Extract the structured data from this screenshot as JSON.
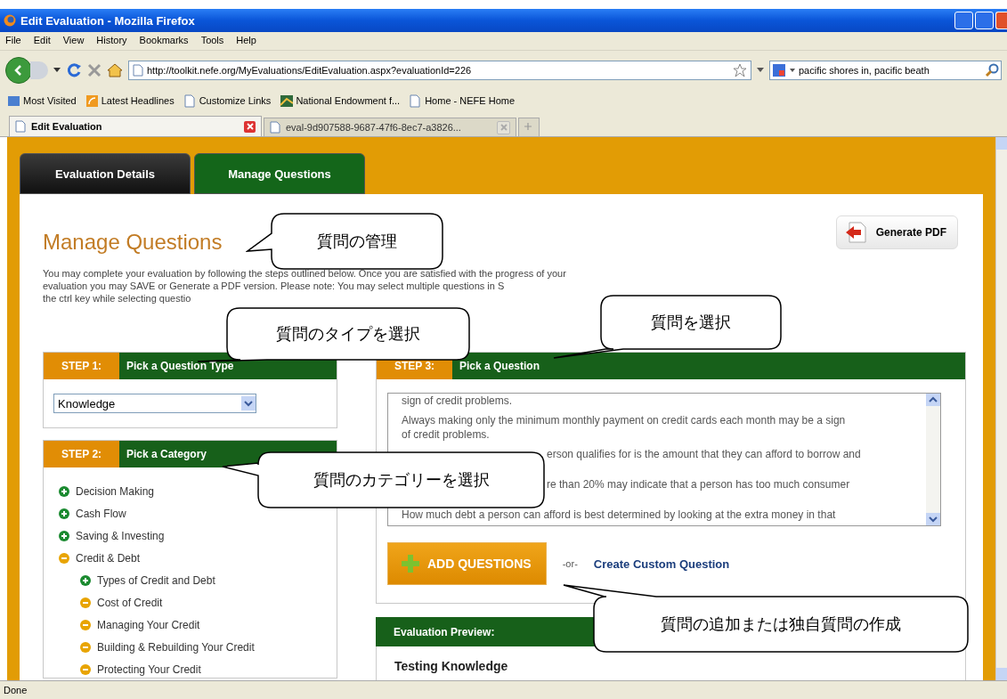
{
  "window": {
    "title": "Edit Evaluation - Mozilla Firefox"
  },
  "menu": [
    "File",
    "Edit",
    "View",
    "History",
    "Bookmarks",
    "Tools",
    "Help"
  ],
  "toolbar": {
    "url": "http://toolkit.nefe.org/MyEvaluations/EditEvaluation.aspx?evaluationId=226",
    "search_value": "pacific shores in, pacific beath"
  },
  "bookmarks": [
    {
      "kind": "rss",
      "label": "Most Visited"
    },
    {
      "kind": "feed",
      "label": "Latest Headlines"
    },
    {
      "kind": "page",
      "label": "Customize Links"
    },
    {
      "kind": "site",
      "label": "National Endowment f..."
    },
    {
      "kind": "page",
      "label": "Home - NEFE Home"
    }
  ],
  "browser_tabs": [
    {
      "label": "Edit Evaluation",
      "selected": true
    },
    {
      "label": "eval-9d907588-9687-47f6-8ec7-a3826...",
      "selected": false
    }
  ],
  "page": {
    "tabs": [
      {
        "label": "Evaluation Details",
        "selected": false
      },
      {
        "label": "Manage Questions",
        "selected": true
      }
    ],
    "heading": "Manage Questions",
    "pdf_button": "Generate PDF",
    "intro_lines": [
      "You may complete your evaluation by following the steps outlined below. Once you are satisfied with the progress of your",
      "evaluation you may SAVE or Generate a PDF version. Please note: You may select multiple questions in S",
      "the ctrl key while selecting questio"
    ],
    "step1": {
      "step": "STEP 1:",
      "title": "Pick a Question Type",
      "select_value": "Knowledge"
    },
    "step2": {
      "step": "STEP 2:",
      "title": "Pick a Category",
      "categories": [
        {
          "label": "Decision Making",
          "expanded": false
        },
        {
          "label": "Cash Flow",
          "expanded": false
        },
        {
          "label": "Saving & Investing",
          "expanded": false
        },
        {
          "label": "Credit & Debt",
          "expanded": true,
          "children": [
            {
              "label": "Types of Credit and Debt",
              "expanded": false
            },
            {
              "label": "Cost of Credit",
              "expanded": true
            },
            {
              "label": "Managing Your Credit",
              "expanded": true
            },
            {
              "label": "Building & Rebuilding Your Credit",
              "expanded": true
            },
            {
              "label": "Protecting Your Credit",
              "expanded": true
            }
          ]
        }
      ]
    },
    "step3": {
      "step": "STEP 3:",
      "title": "Pick a Question",
      "questions": [
        {
          "kind": "whole",
          "lines": [
            "sign of credit problems."
          ]
        },
        {
          "kind": "whole",
          "lines": [
            "Always making only the minimum monthly payment on credit cards each month may be a sign",
            "of credit problems."
          ]
        },
        {
          "kind": "cut",
          "lines": [
            "erson qualifies for is the amount that they can afford to borrow and"
          ]
        },
        {
          "kind": "cut",
          "lines": [
            "re than 20% may indicate that a person has too much consumer"
          ]
        },
        {
          "kind": "whole",
          "lines": [
            "How much debt a person can afford is best determined by looking at the extra money in that"
          ]
        }
      ],
      "add_button": "ADD QUESTIONS",
      "or": "-or-",
      "custom_link": "Create Custom Question"
    },
    "preview": {
      "title": "Evaluation Preview:",
      "name": "Testing Knowledge"
    }
  },
  "callouts": [
    "質問の管理",
    "質問のタイプを選択",
    "質問を選択",
    "質問のカテゴリーを選択",
    "質問の追加または独自質問の作成"
  ],
  "status_bar": "Done"
}
